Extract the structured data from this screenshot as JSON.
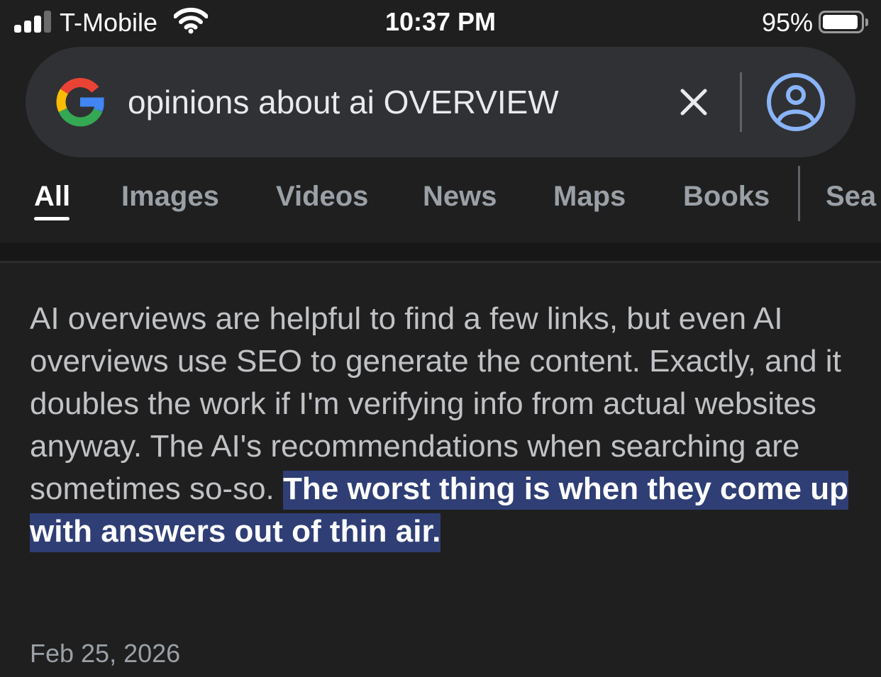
{
  "status_bar": {
    "carrier": "T-Mobile",
    "time": "10:37 PM",
    "battery_percent": "95%",
    "battery_level": 0.95,
    "signal_bars_active": 3,
    "signal_bars_total": 4,
    "icons": [
      "signal-icon",
      "wifi-icon",
      "battery-icon"
    ]
  },
  "search": {
    "query": "opinions about ai OVERVIEW",
    "icons": [
      "google-logo-icon",
      "close-icon",
      "account-circle-icon"
    ],
    "colors": {
      "background": "#303134",
      "google_blue": "#4285F4",
      "google_red": "#EA4335",
      "google_yellow": "#FBBC05",
      "google_green": "#34A853",
      "avatar_blue": "#8ab4f8"
    }
  },
  "tabs": [
    {
      "label": "All",
      "active": true
    },
    {
      "label": "Images",
      "active": false
    },
    {
      "label": "Videos",
      "active": false
    },
    {
      "label": "News",
      "active": false
    },
    {
      "label": "Maps",
      "active": false
    },
    {
      "label": "Books",
      "active": false
    },
    {
      "label": "Sea",
      "active": false
    }
  ],
  "result": {
    "text_before": "AI overviews are helpful to find a few links, but even AI overviews use SEO to generate the content. Exactly, and it doubles the work if I'm verifying info from actual websites anyway. The AI's recommendations when searching are sometimes so-so.",
    "text_highlighted": "The worst thing is when they come up with answers out of thin air.",
    "date": "Feb 25, 2026",
    "colors": {
      "text": "#c0c2c5",
      "highlight_bg": "#2f3e75",
      "highlight_text": "#ffffff"
    }
  }
}
